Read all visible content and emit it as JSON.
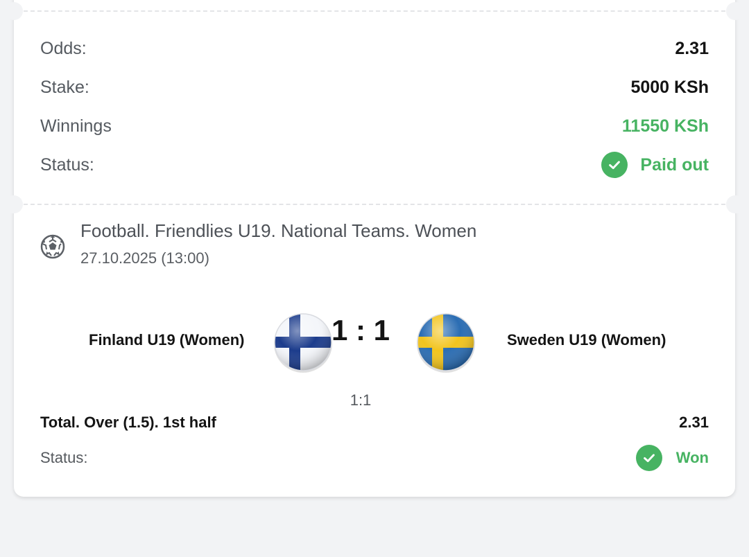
{
  "summary": {
    "odds_label": "Odds:",
    "odds_value": "2.31",
    "stake_label": "Stake:",
    "stake_value": "5000 KSh",
    "winnings_label": "Winnings",
    "winnings_value": "11550 KSh",
    "status_label": "Status:",
    "status_value": "Paid out"
  },
  "event": {
    "sport_icon": "football-icon",
    "title": "Football. Friendlies U19. National Teams. Women",
    "datetime": "27.10.2025 (13:00)",
    "home_team": "Finland U19 (Women)",
    "away_team": "Sweden U19 (Women)",
    "home_flag": "finland-flag-icon",
    "away_flag": "sweden-flag-icon",
    "score": "1 : 1",
    "half_score": "1:1"
  },
  "bet": {
    "market": "Total. Over (1.5). 1st half",
    "odds": "2.31",
    "status_label": "Status:",
    "status_value": "Won"
  },
  "colors": {
    "accent_green": "#47b362",
    "background": "#f2f3f5",
    "card": "#ffffff"
  }
}
